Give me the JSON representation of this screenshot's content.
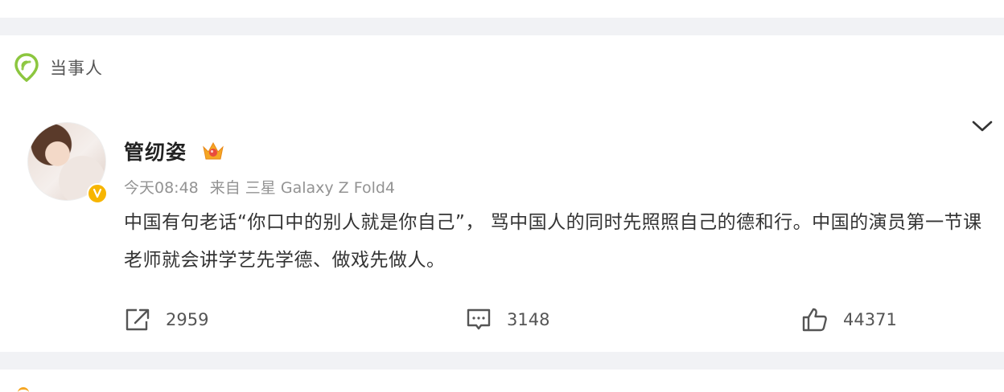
{
  "section": {
    "tag_label": "当事人",
    "tag_icon": "location-pin-icon"
  },
  "post": {
    "user_name": "管纫姿",
    "badge_icon": "crown-icon",
    "verified_icon": "verified-badge-icon",
    "time": "今天08:48",
    "source": "来自 三星 Galaxy Z Fold4",
    "text": "中国有句老话“你口中的别人就是你自己”，  骂中国人的同时先照照自己的德和行。中国的演员第一节课老师就会讲学艺先学德、做戏先做人。",
    "more_icon": "chevron-down-icon"
  },
  "actions": {
    "repost": {
      "icon": "share-icon",
      "count": "2959"
    },
    "comment": {
      "icon": "comment-icon",
      "count": "3148"
    },
    "like": {
      "icon": "thumbs-up-icon",
      "count": "44371"
    }
  },
  "colors": {
    "page_bg": "#f1f2f5",
    "card_bg": "#ffffff",
    "tag_icon": "#8cc63f",
    "verified": "#f7b500",
    "meta_text": "#939393"
  }
}
